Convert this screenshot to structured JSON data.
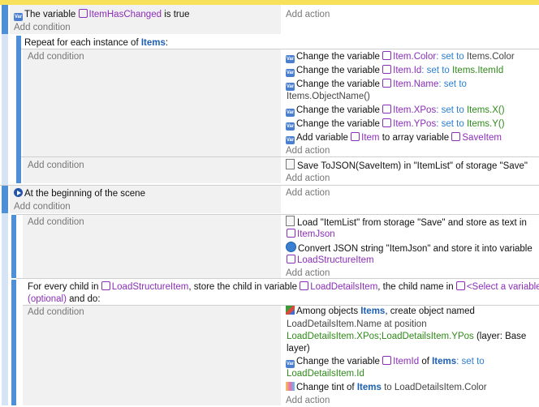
{
  "common": {
    "add_condition": "Add condition",
    "add_action": "Add action"
  },
  "event1": {
    "cond": {
      "prefix": "The variable",
      "var": "ItemHasChanged",
      "suffix": "is true"
    }
  },
  "repeat": {
    "header_prefix": "Repeat for each instance of",
    "object": "Items",
    "header_suffix": ":",
    "actions": [
      {
        "prefix": "Change the variable",
        "var": "Item.Color",
        "op": ": set to",
        "value": "Items.Color"
      },
      {
        "prefix": "Change the variable",
        "var": "Item.Id",
        "op": ": set to",
        "value": "Items.ItemId"
      },
      {
        "prefix": "Change the variable",
        "var": "Item.Name",
        "op": ": set to",
        "value": "Items.ObjectName()"
      },
      {
        "prefix": "Change the variable",
        "var": "Item.XPos",
        "op": ": set to",
        "value": "Items.X()"
      },
      {
        "prefix": "Change the variable",
        "var": "Item.YPos",
        "op": ": set to",
        "value": "Items.Y()"
      },
      {
        "prefix": "Add variable",
        "var": "Item",
        "mid": "to array variable",
        "target": "SaveItem"
      }
    ]
  },
  "save": {
    "text": "Save ToJSON(SaveItem) in \"ItemList\" of storage \"Save\""
  },
  "scene": {
    "cond": "At the beginning of the scene",
    "load": {
      "text": "Load \"ItemList\" from storage \"Save\" and store as text in",
      "var": "ItemJson"
    },
    "convert": {
      "text": "Convert JSON string \"ItemJson\" and store it into variable",
      "var": "LoadStructureItem"
    }
  },
  "foreach": {
    "p1": "For every child in",
    "v1": "LoadStructureItem",
    "p2": ", store the child in variable",
    "v2": "LoadDetailsItem",
    "p3": ", the child name in",
    "v3": "<Select a variable>",
    "p4": "(optional)",
    "p5": "and do:",
    "create": {
      "p1": "Among objects",
      "obj": "Items",
      "p2": ", create object named",
      "line2": "LoadDetailsItem.Name at position",
      "pos": "LoadDetailsItem.XPos;LoadDetailsItem.YPos",
      "layer": "(layer: Base",
      "layer2": "layer)"
    },
    "change": {
      "prefix": "Change the variable",
      "var": "ItemId",
      "of": "of",
      "obj": "Items",
      "op": ": set to",
      "value": "LoadDetailsItem.Id"
    },
    "tint": {
      "prefix": "Change tint of",
      "obj": "Items",
      "to": "to LoadDetailsItem.Color"
    }
  }
}
